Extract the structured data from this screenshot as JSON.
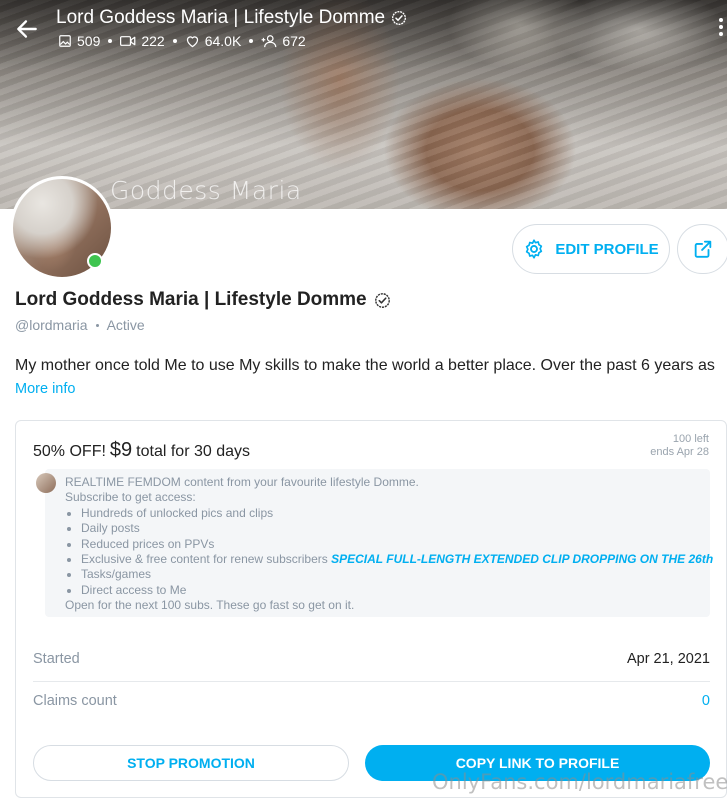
{
  "header": {
    "title": "Lord Goddess Maria | Lifestyle Domme",
    "stats": {
      "photos": "509",
      "videos": "222",
      "likes": "64.0K",
      "fans": "672"
    },
    "cover_watermark": "Goddess Maria"
  },
  "profile": {
    "name": "Lord Goddess Maria | Lifestyle Domme",
    "handle": "@lordmaria",
    "status": "Active",
    "bio": "My mother once told Me to use My skills to make the world a better place. Over the past 6 years as",
    "more_info": "More info",
    "edit_label": "EDIT PROFILE"
  },
  "promo": {
    "discount": "50% OFF!",
    "price": "$9",
    "terms": "total for 30 days",
    "left": "100 left",
    "ends": "ends Apr 28",
    "message_intro": "REALTIME FEMDOM content from your favourite lifestyle Domme.",
    "message_sub": "Subscribe to get access:",
    "items": [
      "Hundreds of unlocked pics and clips",
      "Daily posts",
      "Reduced prices on PPVs",
      "Exclusive & free content for renew subscribers",
      "Tasks/games",
      "Direct access to Me"
    ],
    "special_note": "SPECIAL FULL-LENGTH EXTENDED CLIP DROPPING ON THE 26th",
    "message_outro": "Open for the next 100 subs. These go fast so get on it.",
    "started_label": "Started",
    "started_value": "Apr 21, 2021",
    "claims_label": "Claims count",
    "claims_value": "0",
    "stop_label": "STOP PROMOTION",
    "copy_label": "COPY LINK TO PROFILE"
  },
  "watermark": "OnlyFans.com/lordmariafree",
  "colors": {
    "accent": "#00aff0",
    "online": "#3ec44f",
    "muted": "#8a96a3"
  }
}
